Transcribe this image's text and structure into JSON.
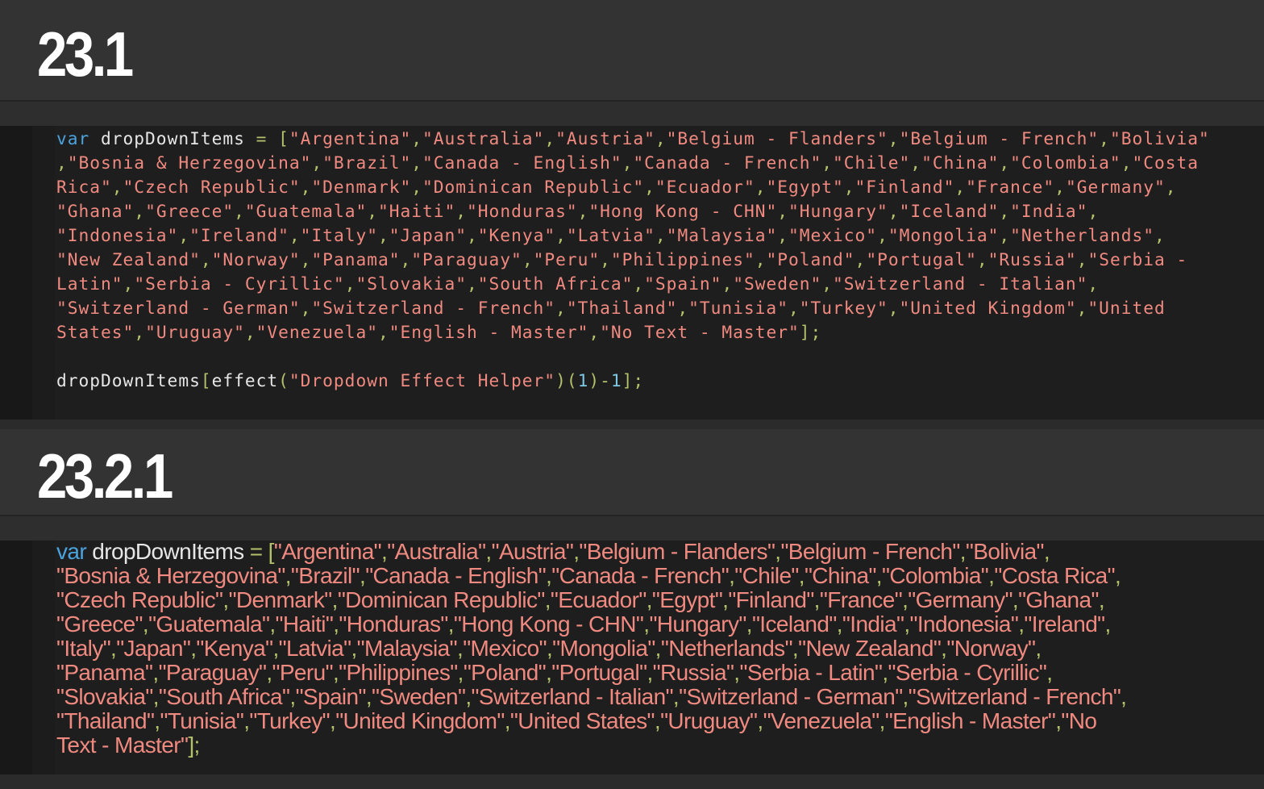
{
  "sections": [
    {
      "version": "23.1",
      "code_lines": [
        "var dropDownItems = [\"Argentina\",\"Australia\",\"Austria\",\"Belgium - Flanders\",\"Belgium - French\",\"Bolivia\"",
        ",\"Bosnia & Herzegovina\",\"Brazil\",\"Canada - English\",\"Canada - French\",\"Chile\",\"China\",\"Colombia\",\"Costa",
        "Rica\",\"Czech Republic\",\"Denmark\",\"Dominican Republic\",\"Ecuador\",\"Egypt\",\"Finland\",\"France\",\"Germany\",",
        "\"Ghana\",\"Greece\",\"Guatemala\",\"Haiti\",\"Honduras\",\"Hong Kong - CHN\",\"Hungary\",\"Iceland\",\"India\",",
        "\"Indonesia\",\"Ireland\",\"Italy\",\"Japan\",\"Kenya\",\"Latvia\",\"Malaysia\",\"Mexico\",\"Mongolia\",\"Netherlands\",",
        "\"New Zealand\",\"Norway\",\"Panama\",\"Paraguay\",\"Peru\",\"Philippines\",\"Poland\",\"Portugal\",\"Russia\",\"Serbia -",
        "Latin\",\"Serbia - Cyrillic\",\"Slovakia\",\"South Africa\",\"Spain\",\"Sweden\",\"Switzerland - Italian\",",
        "\"Switzerland - German\",\"Switzerland - French\",\"Thailand\",\"Tunisia\",\"Turkey\",\"United Kingdom\",\"United",
        "States\",\"Uruguay\",\"Venezuela\",\"English - Master\",\"No Text - Master\"];",
        "",
        "dropDownItems[effect(\"Dropdown Effect Helper\")(1)-1];"
      ]
    },
    {
      "version": "23.2.1",
      "code_lines": [
        "var dropDownItems = [\"Argentina\",\"Australia\",\"Austria\",\"Belgium - Flanders\",\"Belgium - French\",\"Bolivia\",",
        "\"Bosnia & Herzegovina\",\"Brazil\",\"Canada - English\",\"Canada - French\",\"Chile\",\"China\",\"Colombia\",\"Costa Rica\",",
        "\"Czech Republic\",\"Denmark\",\"Dominican Republic\",\"Ecuador\",\"Egypt\",\"Finland\",\"France\",\"Germany\",\"Ghana\",",
        "\"Greece\",\"Guatemala\",\"Haiti\",\"Honduras\",\"Hong Kong - CHN\",\"Hungary\",\"Iceland\",\"India\",\"Indonesia\",\"Ireland\",",
        "\"Italy\",\"Japan\",\"Kenya\",\"Latvia\",\"Malaysia\",\"Mexico\",\"Mongolia\",\"Netherlands\",\"New Zealand\",\"Norway\",",
        "\"Panama\",\"Paraguay\",\"Peru\",\"Philippines\",\"Poland\",\"Portugal\",\"Russia\",\"Serbia - Latin\",\"Serbia - Cyrillic\",",
        "\"Slovakia\",\"South Africa\",\"Spain\",\"Sweden\",\"Switzerland - Italian\",\"Switzerland - German\",\"Switzerland - French\",",
        "\"Thailand\",\"Tunisia\",\"Turkey\",\"United Kingdom\",\"United States\",\"Uruguay\",\"Venezuela\",\"English - Master\",\"No",
        "Text - Master\"];"
      ]
    }
  ],
  "colors": {
    "keyword": "#4aa3df",
    "identifier": "#e6e6e6",
    "operator": "#b5c06a",
    "string": "#f08a80",
    "number": "#7ec8e3",
    "editor_background": "#1e1e1e",
    "header_background": "#333333"
  }
}
